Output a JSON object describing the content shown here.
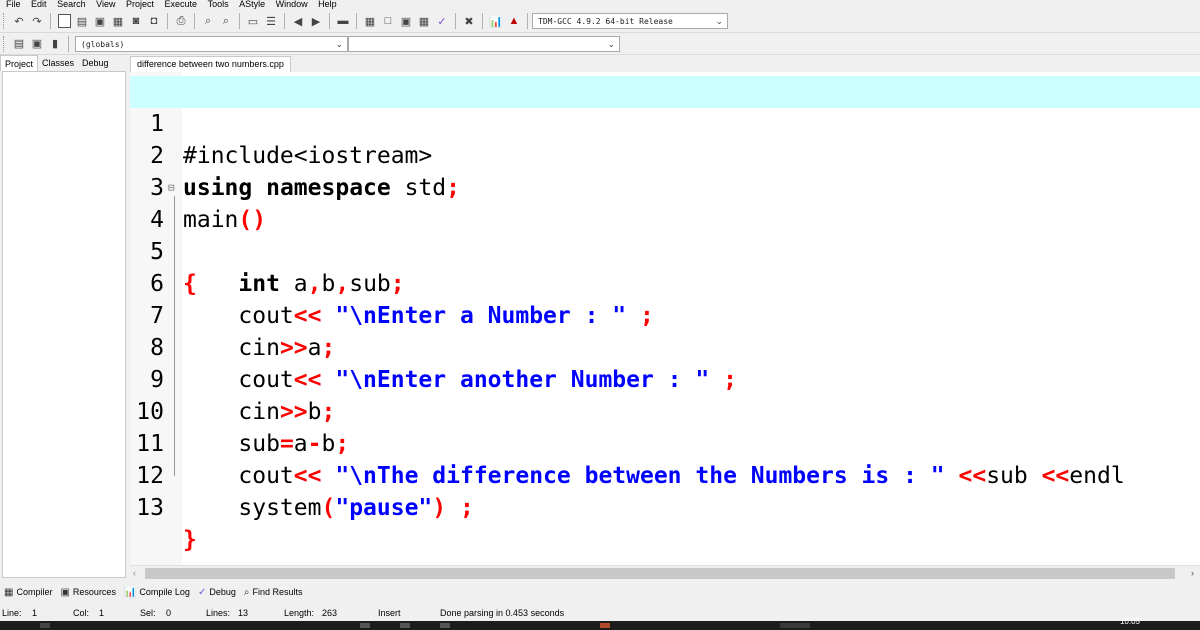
{
  "menu": [
    "File",
    "Edit",
    "Search",
    "View",
    "Project",
    "Execute",
    "Tools",
    "AStyle",
    "Window",
    "Help"
  ],
  "toolbar": {
    "compiler_select": "TDM-GCC 4.9.2 64-bit Release",
    "scope_select": "(globals)",
    "member_select": ""
  },
  "left_panel": {
    "tabs": [
      "Project",
      "Classes",
      "Debug"
    ],
    "active_tab": "Project"
  },
  "editor": {
    "tab": "difference between two numbers.cpp",
    "current_line": 1
  },
  "bottom_tabs": [
    "Compiler",
    "Resources",
    "Compile Log",
    "Debug",
    "Find Results"
  ],
  "status": {
    "line_label": "Line:",
    "line": "1",
    "col_label": "Col:",
    "col": "1",
    "sel_label": "Sel:",
    "sel": "0",
    "lines_label": "Lines:",
    "lines": "13",
    "length_label": "Length:",
    "length": "263",
    "mode": "Insert",
    "message": "Done parsing in 0.453 seconds"
  },
  "taskbar": {
    "clock": "10:05"
  },
  "colors": {
    "current_line": "#ccffff",
    "string": "#0000ff",
    "symbol": "#ff0000"
  }
}
